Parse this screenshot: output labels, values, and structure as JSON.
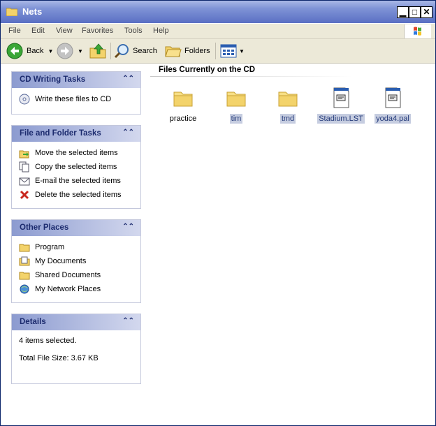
{
  "window": {
    "title": "Nets"
  },
  "title_buttons": {
    "minimize": "▁",
    "maximize": "□",
    "close": "✕"
  },
  "menu": [
    "File",
    "Edit",
    "View",
    "Favorites",
    "Tools",
    "Help"
  ],
  "toolbar": {
    "back_label": "Back",
    "search_label": "Search",
    "folders_label": "Folders"
  },
  "panels": {
    "cd_writing": {
      "title": "CD Writing Tasks",
      "items": [
        {
          "label": "Write these files to CD",
          "icon": "cd-write-icon"
        }
      ]
    },
    "file_folder": {
      "title": "File and Folder Tasks",
      "items": [
        {
          "label": "Move the selected items",
          "icon": "move-icon"
        },
        {
          "label": "Copy the selected items",
          "icon": "copy-icon"
        },
        {
          "label": "E-mail the selected items",
          "icon": "email-icon"
        },
        {
          "label": "Delete the selected items",
          "icon": "delete-icon"
        }
      ]
    },
    "other_places": {
      "title": "Other Places",
      "items": [
        {
          "label": "Program",
          "icon": "folder-icon"
        },
        {
          "label": "My Documents",
          "icon": "my-documents-icon"
        },
        {
          "label": "Shared Documents",
          "icon": "folder-icon"
        },
        {
          "label": "My Network Places",
          "icon": "network-icon"
        }
      ]
    },
    "details": {
      "title": "Details",
      "selected": "4 items selected.",
      "size": "Total File Size: 3.67 KB"
    }
  },
  "files_section": {
    "title": "Files Currently on the CD"
  },
  "files": [
    {
      "name": "practice",
      "type": "folder",
      "selected": false
    },
    {
      "name": "tim",
      "type": "folder",
      "selected": true
    },
    {
      "name": "tmd",
      "type": "folder",
      "selected": true
    },
    {
      "name": "Stadium.LST",
      "type": "file",
      "selected": true
    },
    {
      "name": "yoda4.pal",
      "type": "file",
      "selected": true
    }
  ],
  "colors": {
    "title_bar": "#7f93d6",
    "panel_header": "#8c9bd0",
    "selection": "#c6cde0"
  }
}
